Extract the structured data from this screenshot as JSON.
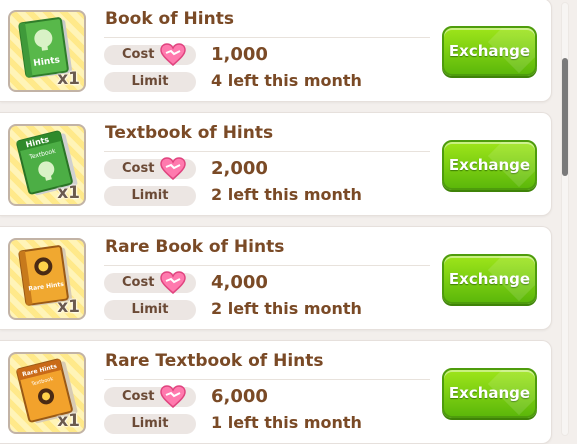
{
  "labels": {
    "cost": "Cost",
    "limit": "Limit",
    "exchange": "Exchange"
  },
  "colors": {
    "title": "#7a4a26",
    "exchange_button": "#7ed321",
    "pill_bg": "#ece6e3",
    "heart": "#ff6fa8"
  },
  "items": [
    {
      "name": "Book of Hints",
      "icon": "green-hint-book-icon",
      "book_text": "Hints",
      "quantity": "x1",
      "cost": "1,000",
      "limit": "4 left this month"
    },
    {
      "name": "Textbook of Hints",
      "icon": "green-hint-textbook-icon",
      "book_text": "Hints",
      "book_subtext": "Textbook",
      "quantity": "x1",
      "cost": "2,000",
      "limit": "2 left this month"
    },
    {
      "name": "Rare Book of Hints",
      "icon": "rare-hint-book-icon",
      "book_text": "Rare Hints",
      "quantity": "x1",
      "cost": "4,000",
      "limit": "2 left this month"
    },
    {
      "name": "Rare Textbook of Hints",
      "icon": "rare-hint-textbook-icon",
      "book_text": "Rare Hints",
      "book_subtext": "Textbook",
      "quantity": "x1",
      "cost": "6,000",
      "limit": "1 left this month"
    }
  ]
}
